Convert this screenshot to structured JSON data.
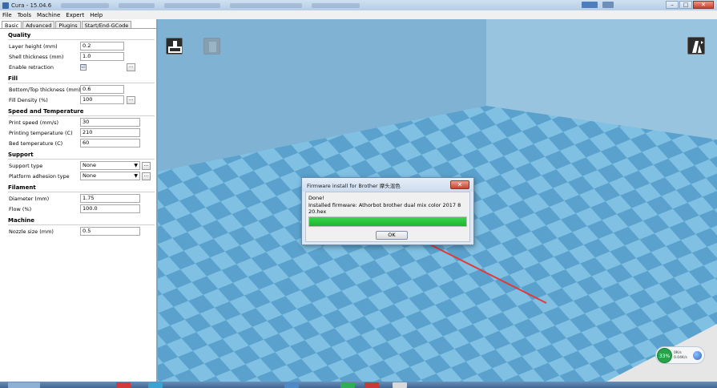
{
  "window": {
    "title": "Cura - 15.04.6",
    "controls": {
      "minimize": "–",
      "maximize": "□",
      "close": "✕"
    }
  },
  "menubar": {
    "items": [
      "File",
      "Tools",
      "Machine",
      "Expert",
      "Help"
    ]
  },
  "tabs": [
    "Basic",
    "Advanced",
    "Plugins",
    "Start/End-GCode"
  ],
  "sections": {
    "quality": {
      "title": "Quality",
      "layer_height": {
        "label": "Layer height (mm)",
        "value": "0.2"
      },
      "shell_thickness": {
        "label": "Shell thickness (mm)",
        "value": "1.0"
      },
      "enable_retraction": {
        "label": "Enable retraction",
        "checked": "☑"
      }
    },
    "fill": {
      "title": "Fill",
      "bottom_top_thickness": {
        "label": "Bottom/Top thickness (mm)",
        "value": "0.6"
      },
      "fill_density": {
        "label": "Fill Density (%)",
        "value": "100"
      }
    },
    "speed": {
      "title": "Speed and Temperature",
      "print_speed": {
        "label": "Print speed (mm/s)",
        "value": "30"
      },
      "printing_temperature": {
        "label": "Printing temperature (C)",
        "value": "210"
      },
      "bed_temperature": {
        "label": "Bed temperature (C)",
        "value": "60"
      }
    },
    "support": {
      "title": "Support",
      "support_type": {
        "label": "Support type",
        "value": "None"
      },
      "platform_adhesion": {
        "label": "Platform adhesion type",
        "value": "None"
      }
    },
    "filament": {
      "title": "Filament",
      "diameter": {
        "label": "Diameter (mm)",
        "value": "1.75"
      },
      "flow": {
        "label": "Flow (%)",
        "value": "100.0"
      }
    },
    "machine": {
      "title": "Machine",
      "nozzle_size": {
        "label": "Nozzle size (mm)",
        "value": "0.5"
      }
    }
  },
  "dots_label": "...",
  "dropdown_arrow": "▼",
  "dialog": {
    "title": "Firmware install for Brother 摩头混色",
    "line1": "Done!",
    "line2": "Installed firmware: Athorbot brother dual mix color 2017 8 20.hex",
    "progress": 1.0,
    "ok_label": "OK",
    "close_label": "✕"
  },
  "net_widget": {
    "percent": "33%",
    "up": "0K/s",
    "down": "0.04K/s"
  },
  "colors": {
    "floor_light": "#7fc0e3",
    "floor_dark": "#5aa2cd",
    "wall_back": "#8fbcd8",
    "wall_left": "#82b3d2",
    "accent_arrow": "#e03a3a",
    "progress_green": "#22c033"
  }
}
